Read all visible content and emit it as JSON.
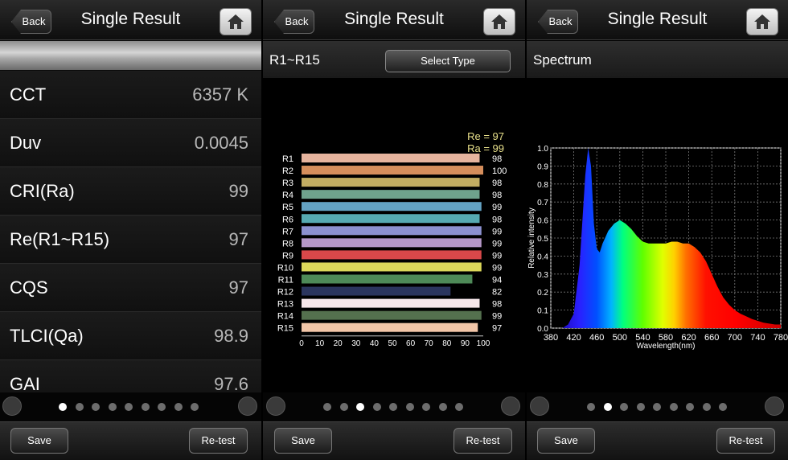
{
  "nav": {
    "back_label": "Back",
    "title": "Single Result"
  },
  "panel1": {
    "rows": [
      {
        "label": "CCT",
        "value": "6357 K"
      },
      {
        "label": "Duv",
        "value": "0.0045"
      },
      {
        "label": "CRI(Ra)",
        "value": "99"
      },
      {
        "label": "Re(R1~R15)",
        "value": "97"
      },
      {
        "label": "CQS",
        "value": "97"
      },
      {
        "label": "TLCI(Qa)",
        "value": "98.9"
      },
      {
        "label": "GAI",
        "value": "97.6"
      }
    ],
    "page_index": 1,
    "page_count": 9
  },
  "panel2": {
    "section_title": "R1~R15",
    "select_label": "Select Type",
    "page_index": 3,
    "page_count": 9
  },
  "panel3": {
    "section_title": "Spectrum",
    "page_index": 2,
    "page_count": 9
  },
  "toolbar": {
    "save_label": "Save",
    "retest_label": "Re-test"
  },
  "chart_data": [
    {
      "type": "bar",
      "orientation": "horizontal",
      "annotations": [
        "Re = 97",
        "Ra = 99"
      ],
      "categories": [
        "R1",
        "R2",
        "R3",
        "R4",
        "R5",
        "R6",
        "R7",
        "R8",
        "R9",
        "R10",
        "R11",
        "R12",
        "R13",
        "R14",
        "R15"
      ],
      "values": [
        98,
        100,
        98,
        98,
        99,
        98,
        99,
        99,
        99,
        99,
        94,
        82,
        98,
        99,
        97
      ],
      "colors": [
        "#e6b49e",
        "#d58e5c",
        "#c2ad62",
        "#6fa28c",
        "#64a3c4",
        "#56aab2",
        "#8c91d0",
        "#b698c9",
        "#d8484a",
        "#dcd85a",
        "#4e8a58",
        "#2b355e",
        "#f6e6ea",
        "#54704e",
        "#f2c6a8"
      ],
      "xlim": [
        0,
        100
      ],
      "xticks": [
        0,
        10,
        20,
        30,
        40,
        50,
        60,
        70,
        80,
        90,
        100
      ]
    },
    {
      "type": "area",
      "xlabel": "Wavelength(nm)",
      "ylabel": "Relative intensity",
      "xlim": [
        380,
        780
      ],
      "ylim": [
        0.0,
        1.0
      ],
      "xticks": [
        380,
        420,
        460,
        500,
        540,
        580,
        620,
        660,
        700,
        740,
        780
      ],
      "yticks": [
        "0.0",
        "0.1",
        "0.2",
        "0.3",
        "0.4",
        "0.5",
        "0.6",
        "0.7",
        "0.8",
        "0.9",
        "1.0"
      ],
      "grid": true,
      "x": [
        380,
        400,
        410,
        420,
        430,
        440,
        445,
        450,
        455,
        460,
        465,
        470,
        480,
        490,
        500,
        510,
        520,
        530,
        540,
        550,
        560,
        570,
        580,
        590,
        600,
        610,
        620,
        630,
        640,
        650,
        660,
        670,
        680,
        690,
        700,
        710,
        720,
        730,
        740,
        750,
        760,
        770,
        780
      ],
      "y": [
        0.0,
        0.0,
        0.02,
        0.08,
        0.35,
        0.85,
        1.0,
        0.9,
        0.58,
        0.44,
        0.42,
        0.47,
        0.54,
        0.58,
        0.6,
        0.58,
        0.55,
        0.51,
        0.48,
        0.47,
        0.47,
        0.47,
        0.47,
        0.48,
        0.48,
        0.47,
        0.47,
        0.45,
        0.42,
        0.37,
        0.3,
        0.23,
        0.17,
        0.13,
        0.1,
        0.08,
        0.065,
        0.05,
        0.04,
        0.03,
        0.025,
        0.02,
        0.02
      ]
    }
  ]
}
